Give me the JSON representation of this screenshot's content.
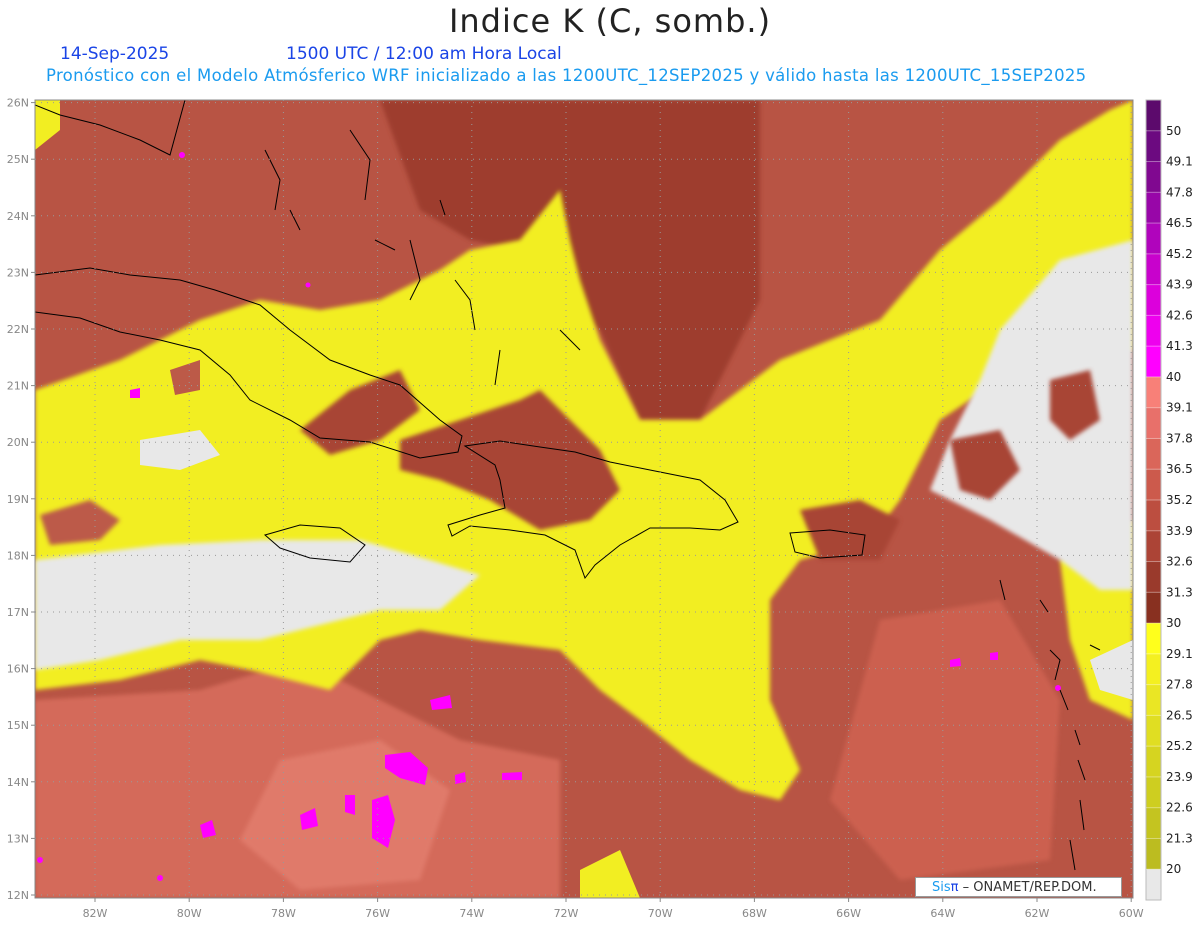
{
  "title": "Indice K (C, somb.)",
  "date": "14-Sep-2025",
  "time": "1500 UTC / 12:00 am Hora Local",
  "subtitle": "Pronóstico con el Modelo Atmósferico WRF inicializado a las 1200UTC_12SEP2025 y válido hasta las  1200UTC_15SEP2025",
  "credit": {
    "logo_a": "Sis",
    "logo_b": "π",
    "text": " – ONAMET/REP.DOM."
  },
  "map": {
    "lon_range": [
      -83.25,
      -60
    ],
    "lat_range": [
      12,
      26
    ],
    "lon_ticks": [
      "82W",
      "80W",
      "78W",
      "76W",
      "74W",
      "72W",
      "70W",
      "68W",
      "66W",
      "64W",
      "62W",
      "60W"
    ],
    "lat_ticks": [
      "26N",
      "25N",
      "24N",
      "23N",
      "22N",
      "21N",
      "20N",
      "19N",
      "18N",
      "17N",
      "16N",
      "15N",
      "14N",
      "13N",
      "12N"
    ]
  },
  "colorbar": {
    "labels": [
      "50",
      "49.1",
      "47.8",
      "46.5",
      "45.2",
      "43.9",
      "42.6",
      "41.3",
      "40",
      "39.1",
      "37.8",
      "36.5",
      "35.2",
      "33.9",
      "32.6",
      "31.3",
      "30",
      "29.1",
      "27.8",
      "26.5",
      "25.2",
      "23.9",
      "22.6",
      "21.3",
      "20"
    ],
    "colors": [
      "#5c0a6c",
      "#6c0a80",
      "#800890",
      "#9806a8",
      "#b004bc",
      "#c802cc",
      "#dc00dc",
      "#ee00ee",
      "#ff00ff",
      "#f88078",
      "#e8706a",
      "#da665a",
      "#cc5a4c",
      "#bc4e40",
      "#ac4436",
      "#9a3a2c",
      "#883020",
      "#ffff1c",
      "#f4f020",
      "#eae624",
      "#e0de22",
      "#d6d420",
      "#cece20",
      "#c4c420",
      "#bcbc20",
      "#e8e8e8"
    ]
  }
}
